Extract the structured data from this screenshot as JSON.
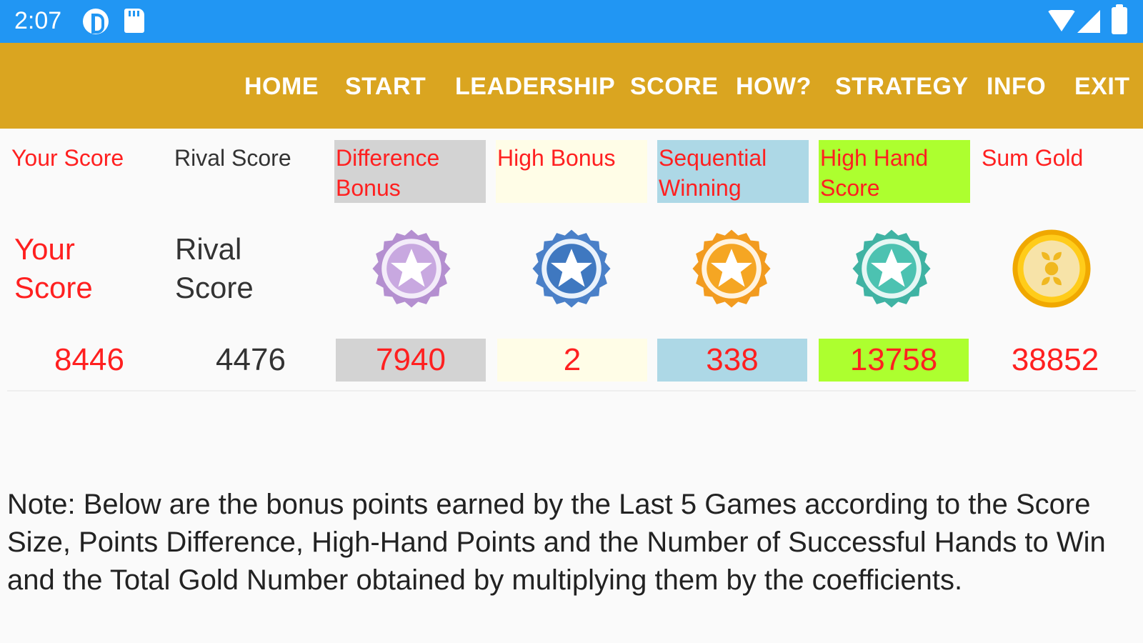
{
  "status_bar": {
    "time": "2:07",
    "icons": [
      "p-icon",
      "sd-card-icon",
      "wifi-icon",
      "signal-icon",
      "battery-icon"
    ]
  },
  "nav": {
    "items": [
      "HOME",
      "START",
      "LEADERSHIP",
      "SCORE",
      "HOW?",
      "STRATEGY",
      "INFO",
      "EXIT"
    ],
    "bg_color": "#daa520"
  },
  "headers": {
    "your_score": "Your Score",
    "rival_score": "Rival Score",
    "difference_bonus": "Difference Bonus",
    "high_bonus": "High Bonus",
    "sequential_winning": "Sequential Winning",
    "high_hand_score": "High Hand Score",
    "sum_gold": "Sum Gold"
  },
  "labels": {
    "your_score": "Your Score",
    "rival_score": "Rival Score"
  },
  "medals": [
    "purple-star-medal-icon",
    "blue-star-medal-icon",
    "orange-star-medal-icon",
    "teal-star-medal-icon",
    "gold-coin-icon"
  ],
  "values": {
    "your_score": "8446",
    "rival_score": "4476",
    "difference_bonus": "7940",
    "high_bonus": "2",
    "sequential_winning": "338",
    "high_hand_score": "13758",
    "sum_gold": "38852"
  },
  "colors": {
    "status_bar": "#2196f3",
    "accent_red": "#ff2020",
    "grey_cell": "#d3d3d3",
    "cream_cell": "#fffde7",
    "blue_cell": "#add8e6",
    "green_cell": "#adff2f"
  },
  "note": "Note: Below are the bonus points earned by the Last 5 Games according to the Score Size, Points Difference, High-Hand Points and the Number of Successful Hands to Win and the Total Gold Number obtained by multiplying them by the coefficients."
}
